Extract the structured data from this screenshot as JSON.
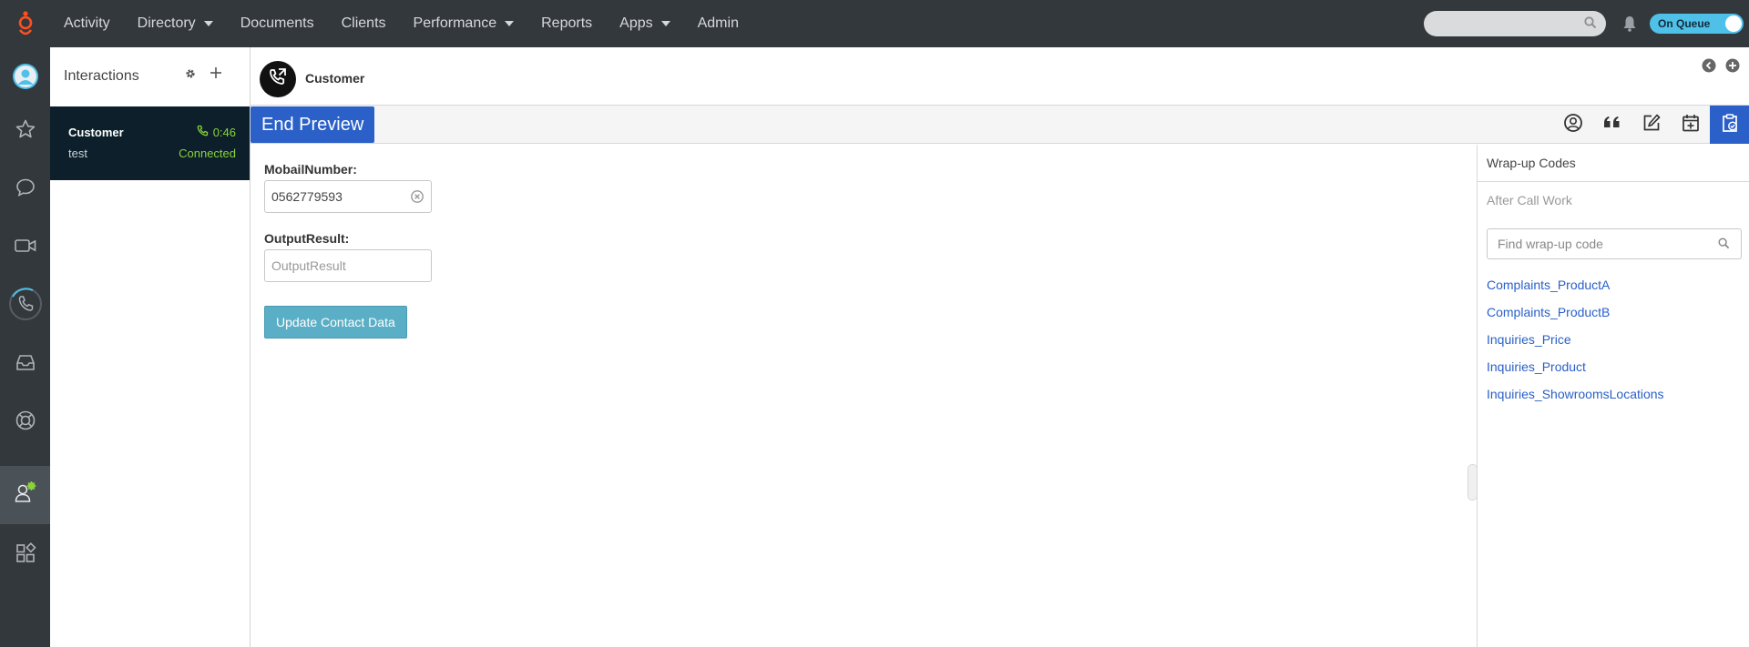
{
  "topbar": {
    "nav": [
      {
        "label": "Activity",
        "dropdown": false
      },
      {
        "label": "Directory",
        "dropdown": true
      },
      {
        "label": "Documents",
        "dropdown": false
      },
      {
        "label": "Clients",
        "dropdown": false
      },
      {
        "label": "Performance",
        "dropdown": true
      },
      {
        "label": "Reports",
        "dropdown": false
      },
      {
        "label": "Apps",
        "dropdown": true
      },
      {
        "label": "Admin",
        "dropdown": false
      }
    ],
    "search_placeholder": "",
    "queue_label": "On Queue"
  },
  "interactions": {
    "title": "Interactions",
    "card": {
      "name": "Customer",
      "time": "0:46",
      "subtitle": "test",
      "status": "Connected"
    }
  },
  "main": {
    "header_name": "Customer",
    "end_preview_label": "End Preview",
    "form": {
      "mobile_label": "MobailNumber:",
      "mobile_value": "0562779593",
      "output_label": "OutputResult:",
      "output_placeholder": "OutputResult",
      "update_label": "Update Contact Data"
    }
  },
  "wrapup": {
    "title": "Wrap-up Codes",
    "acw_label": "After Call Work",
    "search_placeholder": "Find wrap-up code",
    "codes": [
      "Complaints_ProductA",
      "Complaints_ProductB",
      "Inquiries_Price",
      "Inquiries_Product",
      "Inquiries_ShowroomsLocations"
    ]
  },
  "colors": {
    "topbar": "#33383d",
    "accent": "#2a60c8",
    "connected": "#8ad23a",
    "queue": "#4fc0e8",
    "logo": "#ff4f1f"
  }
}
